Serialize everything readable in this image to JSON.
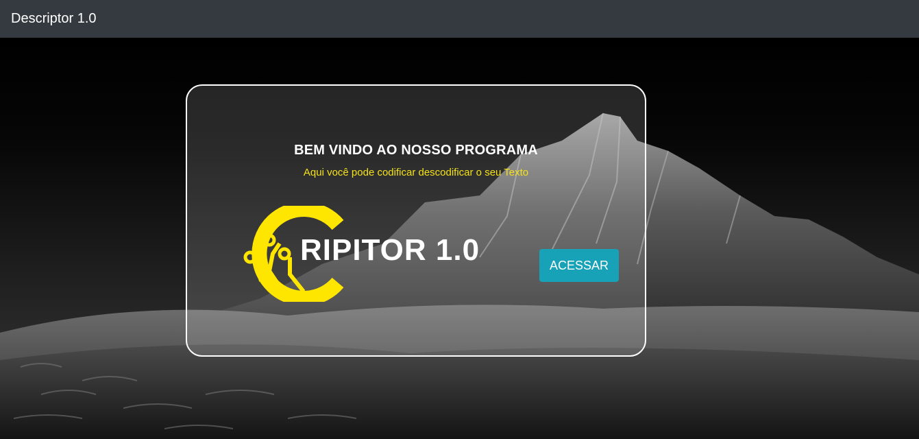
{
  "navbar": {
    "brand": "Descriptor 1.0",
    "background": "#343a40"
  },
  "card": {
    "heading": "BEM VINDO AO NOSSO PROGRAMA",
    "subtitle": "Aqui você pode codificar descodificar o seu Texto",
    "logo_text": "RIPITOR 1.0",
    "access_button": "ACESSAR"
  },
  "colors": {
    "accent": "#17a2b8",
    "subtitle": "#f5e21a",
    "logo_yellow": "#ffe600"
  },
  "icons": {
    "logo": "circuit-c-logo-icon"
  }
}
